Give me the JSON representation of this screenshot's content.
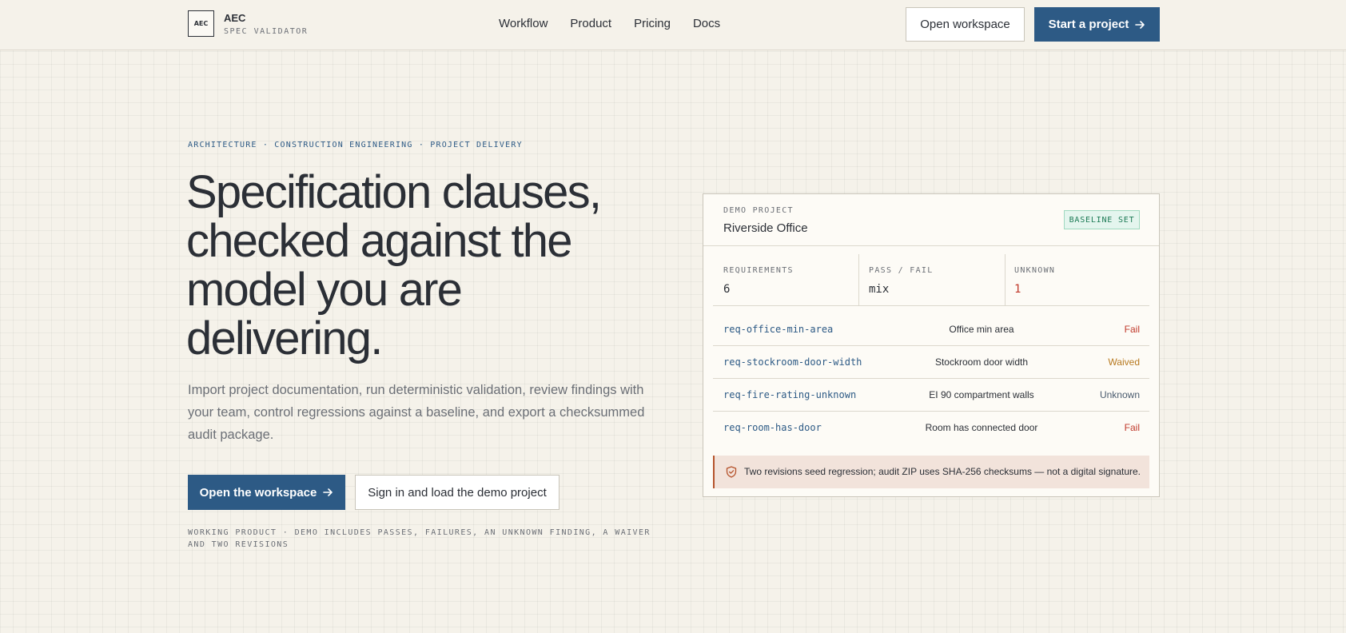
{
  "header": {
    "brand": {
      "mark": "AEC",
      "name": "AEC",
      "subtitle": "SPEC VALIDATOR"
    },
    "nav": [
      "Workflow",
      "Product",
      "Pricing",
      "Docs"
    ],
    "open_workspace": "Open workspace",
    "start_project": "Start a project"
  },
  "hero": {
    "eyebrow": "ARCHITECTURE · CONSTRUCTION ENGINEERING · PROJECT DELIVERY",
    "headline": "Specification clauses, checked against the model you are delivering.",
    "lede": "Import project documentation, run deterministic validation, review findings with your team, control regressions against a baseline, and export a checksummed audit package.",
    "primary_cta": "Open the workspace",
    "secondary_cta": "Sign in and load the demo project",
    "footnote": "WORKING PRODUCT · DEMO INCLUDES PASSES, FAILURES, AN UNKNOWN FINDING, A WAIVER AND TWO REVISIONS"
  },
  "card": {
    "label": "DEMO PROJECT",
    "title": "Riverside Office",
    "badge": "BASELINE SET",
    "stats": [
      {
        "label": "REQUIREMENTS",
        "value": "6"
      },
      {
        "label": "PASS / FAIL",
        "value": "mix"
      },
      {
        "label": "UNKNOWN",
        "value": "1"
      }
    ],
    "rows": [
      {
        "id": "req-office-min-area",
        "desc": "Office min area",
        "status": "Fail"
      },
      {
        "id": "req-stockroom-door-width",
        "desc": "Stockroom door width",
        "status": "Waived"
      },
      {
        "id": "req-fire-rating-unknown",
        "desc": "EI 90 compartment walls",
        "status": "Unknown"
      },
      {
        "id": "req-room-has-door",
        "desc": "Room has connected door",
        "status": "Fail"
      }
    ],
    "notice": "Two revisions seed regression; audit ZIP uses SHA-256 checksums — not a digital signature."
  },
  "colors": {
    "accent": "#2d5a85",
    "fail": "#c0392b",
    "waived": "#b7791f",
    "unknown": "#4a5b6e",
    "badge_bg": "#e4f5ee",
    "notice_bg": "#f2e3db"
  },
  "icons": {
    "arrow": "arrow-right-icon",
    "shield": "shield-icon"
  }
}
